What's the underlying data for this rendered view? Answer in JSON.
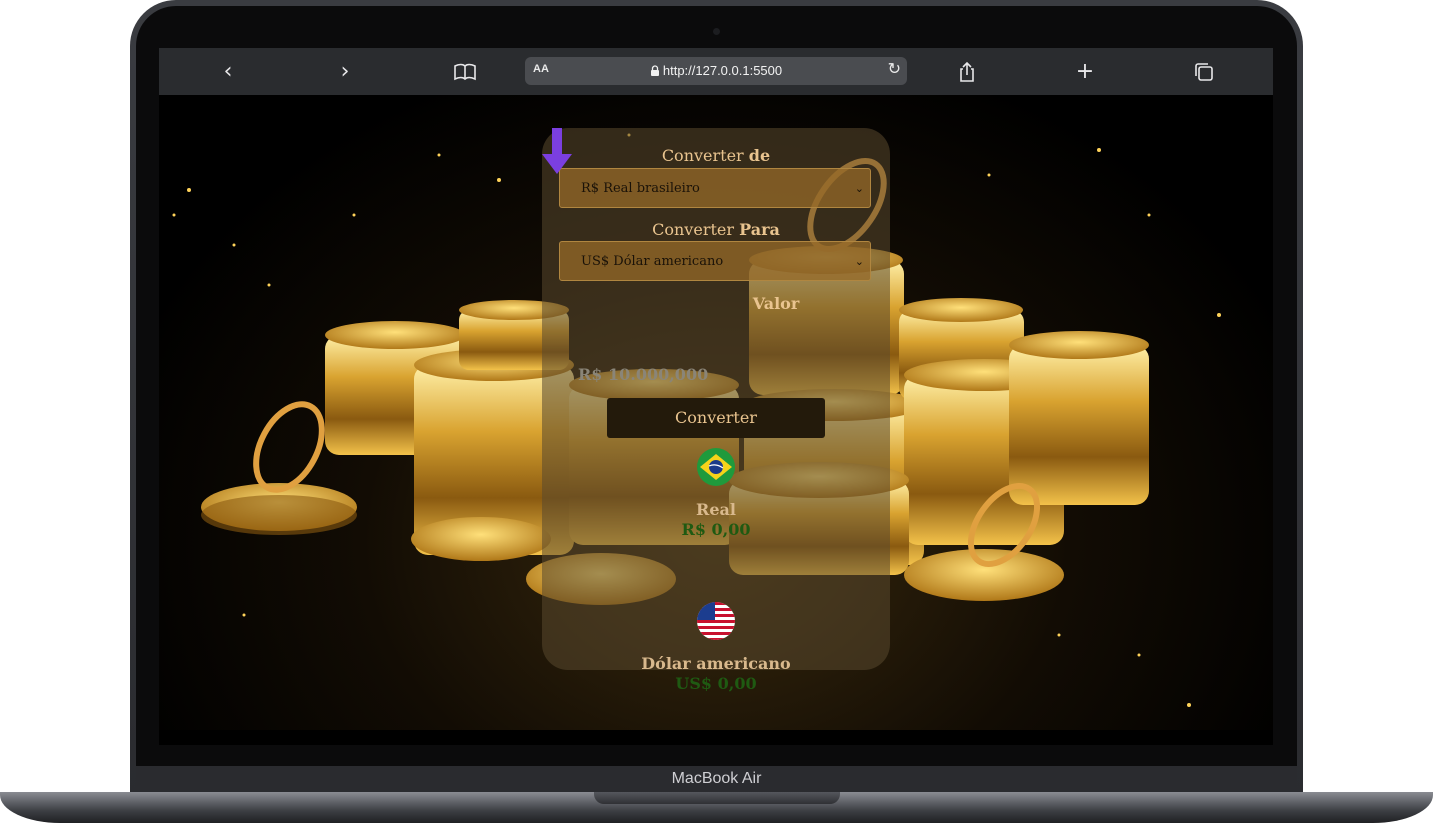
{
  "device": {
    "brand_label": "MacBook Air"
  },
  "browser": {
    "reader_label": "AA",
    "url": "http://127.0.0.1:5500",
    "icons": [
      "back-icon",
      "forward-icon",
      "bookmarks-icon",
      "lock-icon",
      "reload-icon",
      "share-icon",
      "new-tab-icon",
      "tabs-icon"
    ]
  },
  "converter": {
    "from_label_prefix": "Converter",
    "from_label_bold": "de",
    "from_selected": "R$ Real brasileiro",
    "to_label_prefix": "Converter",
    "to_label_bold": "Para",
    "to_selected": "US$ Dólar americano",
    "value_label": "Valor",
    "value_placeholder": "R$ 10.000,000",
    "button_label": "Converter",
    "source_currency_name": "Real",
    "source_currency_value": "R$ 0,00",
    "target_currency_name": "Dólar americano",
    "target_currency_value": "US$ 0,00"
  },
  "colors": {
    "accent_text": "#e9c48f",
    "result_value": "#1f5a12",
    "arrow": "#7b3fe0",
    "browser_toolbar": "#2a2c2f"
  }
}
